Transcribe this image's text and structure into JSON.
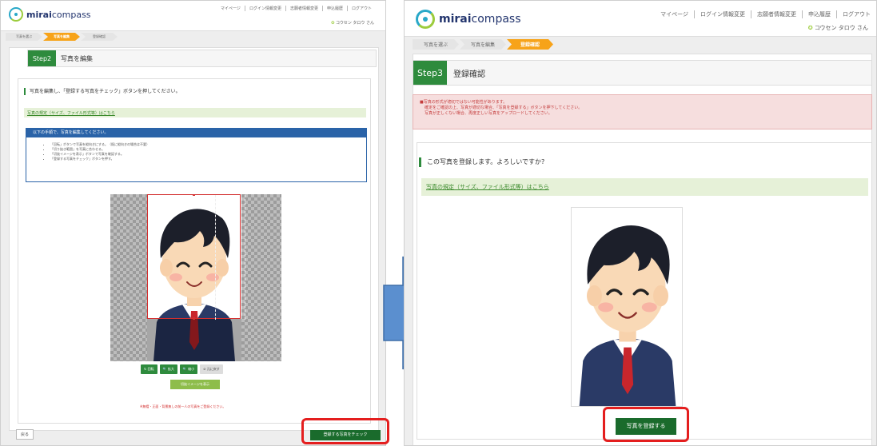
{
  "left": {
    "logo": {
      "bold": "mirai",
      "rest": "compass"
    },
    "topnav": [
      "マイページ",
      "ログイン情報変更",
      "志願者情報変更",
      "申込履歴",
      "ログアウト"
    ],
    "user": "コウセン タロウ さん",
    "crumbs": [
      "写真を選ぶ",
      "写真を編集",
      "登録確認"
    ],
    "step": {
      "badge": "Step2",
      "title": "写真を編集"
    },
    "lead": "写真を編集し、「登録する写真をチェック」ボタンを押してください。",
    "rule_link": "写真の規定（サイズ、ファイル形式等）はこちら",
    "info_title": "以下の手順で、写真を編集してください。",
    "info_items": [
      "「回転」ボタンで写真を縦向きにする。（既に縦向きの場合は不要）",
      "「切り抜き範囲」を写真に合わせる。",
      "「切抜イメージを表示」ボタンで写真を確認する。",
      "「登録する写真をチェック」ボタンを押す。"
    ],
    "tools": [
      "回転",
      "拡大",
      "縮小",
      "元に戻す"
    ],
    "preview_button": "切抜イメージを表示",
    "notice": "※無帽・正面・背景無しの前一人の写真をご登録ください。",
    "back_button": "戻る",
    "check_button": "登録する写真をチェック"
  },
  "right": {
    "logo": {
      "bold": "mirai",
      "rest": "compass"
    },
    "topnav": [
      "マイページ",
      "ログイン情報変更",
      "志願者情報変更",
      "申込履歴",
      "ログアウト"
    ],
    "user": "コウセン タロウ さん",
    "crumbs": [
      "写真を選ぶ",
      "写真を編集",
      "登録確認"
    ],
    "step": {
      "badge": "Step3",
      "title": "登録確認"
    },
    "errors": [
      "■写真の形式が適切ではない可能性があります。",
      "確定をご確認の上、写真が適切な場合、「写真を登録する」ボタンを押下してください。",
      "写真が正しくない場合、再度正しい写真をアップロードしてください。"
    ],
    "lead": "この写真を登録します。よろしいですか?",
    "rule_link": "写真の規定（サイズ、ファイル形式等）はこちら",
    "register_button": "写真を登録する"
  },
  "colors": {
    "accent_green": "#2e8b3d",
    "button_dark_green": "#1a6b2c",
    "crumb_active": "#f7a319",
    "highlight_red": "#e41e1e",
    "arrow_blue": "#5b8fcf",
    "info_blue": "#2a63a8"
  }
}
